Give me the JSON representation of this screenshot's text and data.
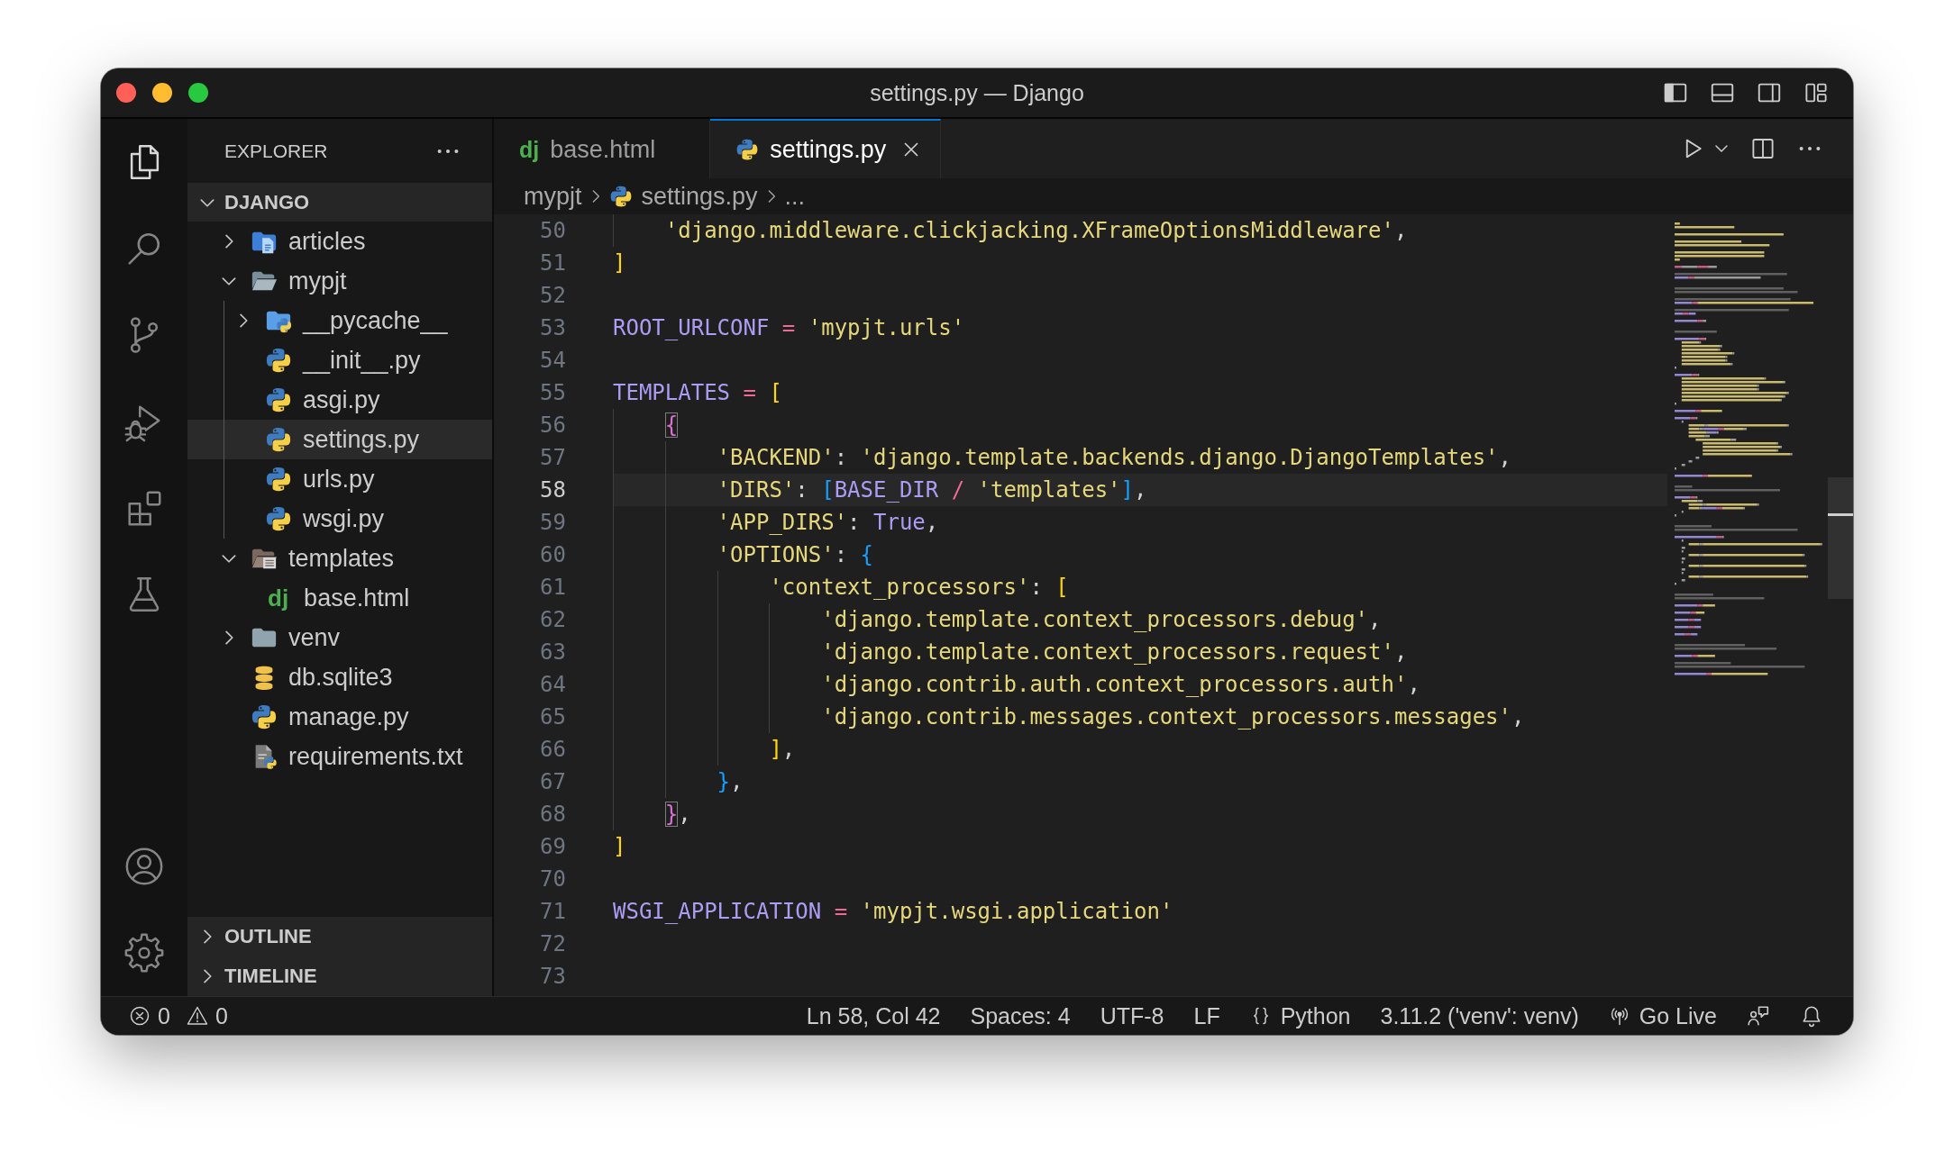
{
  "window": {
    "title": "settings.py — Django"
  },
  "activity_bar": {
    "top": [
      {
        "kind": "explorer",
        "selected": true
      },
      {
        "kind": "search",
        "selected": false
      },
      {
        "kind": "source_control",
        "selected": false
      },
      {
        "kind": "run_debug",
        "selected": false
      },
      {
        "kind": "extensions",
        "selected": false
      },
      {
        "kind": "testing",
        "selected": false
      }
    ],
    "bottom": [
      {
        "kind": "accounts"
      },
      {
        "kind": "manage"
      }
    ]
  },
  "sidebar": {
    "title": "EXPLORER",
    "root": {
      "label": "DJANGO",
      "expanded": true,
      "children": [
        {
          "label": "articles",
          "kind": "docs_folder",
          "expanded": false,
          "selected": false
        },
        {
          "label": "mypjt",
          "kind": "folder",
          "expanded": true,
          "selected": false,
          "children": [
            {
              "label": "__pycache__",
              "kind": "python_folder",
              "expanded": false,
              "selected": false
            },
            {
              "label": "__init__.py",
              "kind": "python",
              "selected": false
            },
            {
              "label": "asgi.py",
              "kind": "python",
              "selected": false
            },
            {
              "label": "settings.py",
              "kind": "python",
              "selected": true
            },
            {
              "label": "urls.py",
              "kind": "python",
              "selected": false
            },
            {
              "label": "wsgi.py",
              "kind": "python",
              "selected": false
            }
          ]
        },
        {
          "label": "templates",
          "kind": "templates_folder",
          "expanded": true,
          "selected": false,
          "children": [
            {
              "label": "base.html",
              "kind": "django",
              "glyph": "dj",
              "selected": false
            }
          ]
        },
        {
          "label": "venv",
          "kind": "folder",
          "expanded": false,
          "selected": false
        },
        {
          "label": "db.sqlite3",
          "kind": "database",
          "selected": false
        },
        {
          "label": "manage.py",
          "kind": "python",
          "selected": false
        },
        {
          "label": "requirements.txt",
          "kind": "requirements",
          "selected": false
        }
      ]
    },
    "sections": [
      {
        "label": "OUTLINE",
        "expanded": false
      },
      {
        "label": "TIMELINE",
        "expanded": false
      }
    ]
  },
  "editor": {
    "tabs": [
      {
        "label": "base.html",
        "kind": "django",
        "glyph": "dj",
        "selected": false
      },
      {
        "label": "settings.py",
        "kind": "python",
        "selected": true
      }
    ],
    "breadcrumbs": [
      {
        "label": "mypjt"
      },
      {
        "label": "settings.py",
        "kind": "python"
      },
      {
        "label": "..."
      }
    ],
    "lines": [
      {
        "number": "50",
        "current": false,
        "tokens": [
          {
            "kind": "string",
            "text": "    'django.middleware.clickjacking.XFrameOptionsMiddleware'"
          },
          {
            "kind": "punct",
            "text": ","
          }
        ]
      },
      {
        "number": "51",
        "current": false,
        "tokens": [
          {
            "kind": "bracket1",
            "text": "]"
          }
        ]
      },
      {
        "number": "52",
        "current": false
      },
      {
        "number": "53",
        "current": false,
        "tokens": [
          {
            "kind": "variable",
            "text": "ROOT_URLCONF"
          },
          {
            "kind": "operator",
            "text": " = "
          },
          {
            "kind": "string",
            "text": "'mypjt.urls'"
          }
        ]
      },
      {
        "number": "54",
        "current": false
      },
      {
        "number": "55",
        "current": false,
        "tokens": [
          {
            "kind": "variable",
            "text": "TEMPLATES"
          },
          {
            "kind": "operator",
            "text": " = "
          },
          {
            "kind": "bracket1",
            "text": "["
          }
        ]
      },
      {
        "number": "56",
        "current": false,
        "tokens": [
          {
            "kind": "bracket2_matched",
            "text": "    {"
          }
        ]
      },
      {
        "number": "57",
        "current": false,
        "tokens": [
          {
            "kind": "string",
            "text": "        'BACKEND'"
          },
          {
            "kind": "punct",
            "text": ": "
          },
          {
            "kind": "string",
            "text": "'django.template.backends.django.DjangoTemplates'"
          },
          {
            "kind": "punct",
            "text": ","
          }
        ]
      },
      {
        "number": "58",
        "current": true,
        "tokens": [
          {
            "kind": "string",
            "text": "        'DIRS'"
          },
          {
            "kind": "punct",
            "text": ": "
          },
          {
            "kind": "bracket3",
            "text": "["
          },
          {
            "kind": "variable",
            "text": "BASE_DIR"
          },
          {
            "kind": "operator",
            "text": " / "
          },
          {
            "kind": "string",
            "text": "'templates'"
          },
          {
            "kind": "bracket3",
            "text": "]"
          },
          {
            "kind": "punct",
            "text": ","
          }
        ]
      },
      {
        "number": "59",
        "current": false,
        "tokens": [
          {
            "kind": "string",
            "text": "        'APP_DIRS'"
          },
          {
            "kind": "punct",
            "text": ": "
          },
          {
            "kind": "constant",
            "text": "True"
          },
          {
            "kind": "punct",
            "text": ","
          }
        ]
      },
      {
        "number": "60",
        "current": false,
        "tokens": [
          {
            "kind": "string",
            "text": "        'OPTIONS'"
          },
          {
            "kind": "punct",
            "text": ": "
          },
          {
            "kind": "bracket3",
            "text": "{"
          }
        ]
      },
      {
        "number": "61",
        "current": false,
        "tokens": [
          {
            "kind": "string",
            "text": "            'context_processors'"
          },
          {
            "kind": "punct",
            "text": ": "
          },
          {
            "kind": "bracket1",
            "text": "["
          }
        ]
      },
      {
        "number": "62",
        "current": false,
        "tokens": [
          {
            "kind": "string",
            "text": "                'django.template.context_processors.debug'"
          },
          {
            "kind": "punct",
            "text": ","
          }
        ]
      },
      {
        "number": "63",
        "current": false,
        "tokens": [
          {
            "kind": "string",
            "text": "                'django.template.context_processors.request'"
          },
          {
            "kind": "punct",
            "text": ","
          }
        ]
      },
      {
        "number": "64",
        "current": false,
        "tokens": [
          {
            "kind": "string",
            "text": "                'django.contrib.auth.context_processors.auth'"
          },
          {
            "kind": "punct",
            "text": ","
          }
        ]
      },
      {
        "number": "65",
        "current": false,
        "tokens": [
          {
            "kind": "string",
            "text": "                'django.contrib.messages.context_processors.messages'"
          },
          {
            "kind": "punct",
            "text": ","
          }
        ]
      },
      {
        "number": "66",
        "current": false,
        "tokens": [
          {
            "kind": "bracket1",
            "text": "            ]"
          },
          {
            "kind": "punct",
            "text": ","
          }
        ]
      },
      {
        "number": "67",
        "current": false,
        "tokens": [
          {
            "kind": "bracket3",
            "text": "        }"
          },
          {
            "kind": "punct",
            "text": ","
          }
        ]
      },
      {
        "number": "68",
        "current": false,
        "tokens": [
          {
            "kind": "bracket2_matched",
            "text": "    }"
          },
          {
            "kind": "punct",
            "text": ","
          }
        ]
      },
      {
        "number": "69",
        "current": false,
        "tokens": [
          {
            "kind": "bracket1",
            "text": "]"
          }
        ]
      },
      {
        "number": "70",
        "current": false
      },
      {
        "number": "71",
        "current": false,
        "tokens": [
          {
            "kind": "variable",
            "text": "WSGI_APPLICATION"
          },
          {
            "kind": "operator",
            "text": " = "
          },
          {
            "kind": "string",
            "text": "'mypjt.wsgi.application'"
          }
        ]
      },
      {
        "number": "72",
        "current": false
      },
      {
        "number": "73",
        "current": false
      }
    ]
  },
  "status_bar": {
    "errors": "0",
    "warnings": "0",
    "items": [
      {
        "label": "Ln 58, Col 42"
      },
      {
        "label": "Spaces: 4"
      },
      {
        "label": "UTF-8"
      },
      {
        "label": "LF"
      },
      {
        "kind": "language",
        "label": "Python"
      },
      {
        "label": "3.11.2 ('venv': venv)"
      },
      {
        "kind": "live_server",
        "label": "Go Live"
      },
      {
        "kind": "feedback"
      },
      {
        "kind": "notifications"
      }
    ]
  }
}
